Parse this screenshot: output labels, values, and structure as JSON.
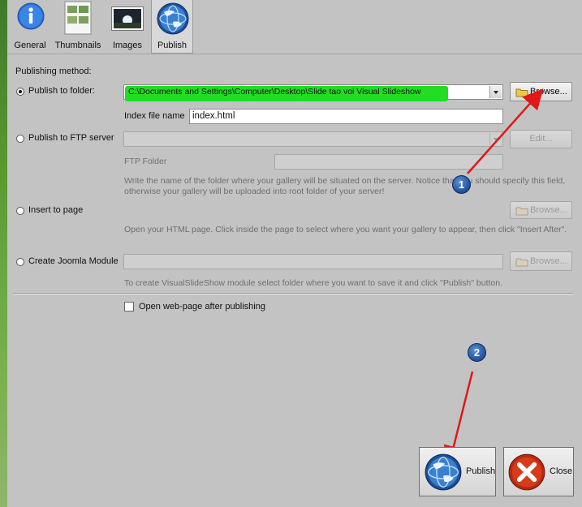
{
  "toolbar": {
    "tabs": [
      {
        "label": "General",
        "icon": "info-icon"
      },
      {
        "label": "Thumbnails",
        "icon": "thumbnails-icon"
      },
      {
        "label": "Images",
        "icon": "images-icon"
      },
      {
        "label": "Publish",
        "icon": "globe-icon"
      }
    ],
    "active_tab": "Publish"
  },
  "publish": {
    "section_label": "Publishing method:",
    "folder": {
      "label": "Publish to folder:",
      "path": "C:\\Documents and Settings\\Computer\\Desktop\\Slide tao voi Visual Slideshow",
      "browse_label": "Browse...",
      "index_label": "Index file name",
      "index_value": "index.html",
      "selected": true
    },
    "ftp": {
      "label": "Publish to FTP server",
      "edit_label": "Edit...",
      "folder_label": "FTP Folder",
      "hint": "Write the name of the folder where your gallery will be situated on the server. Notice that you should specify this field, otherwise your gallery will be uploaded into root folder of your server!"
    },
    "insert": {
      "label": "Insert to page",
      "browse_label": "Browse...",
      "hint": "Open your HTML page. Click inside the page to select where you want your gallery to appear, then click \"Insert After\"."
    },
    "joomla": {
      "label": "Create Joomla Module",
      "browse_label": "Browse...",
      "hint": "To create VisualSlideShow module select folder where you want to save it and click \"Publish\" button."
    },
    "open_after": {
      "label": "Open web-page after publishing",
      "checked": false
    }
  },
  "annotations": [
    {
      "number": "1"
    },
    {
      "number": "2"
    }
  ],
  "footer": {
    "publish_label": "Publish",
    "close_label": "Close"
  },
  "colors": {
    "highlight": "#22dd22",
    "arrow": "#e01818",
    "badge": "#1f4f9a",
    "close_red": "#d83a1a"
  }
}
